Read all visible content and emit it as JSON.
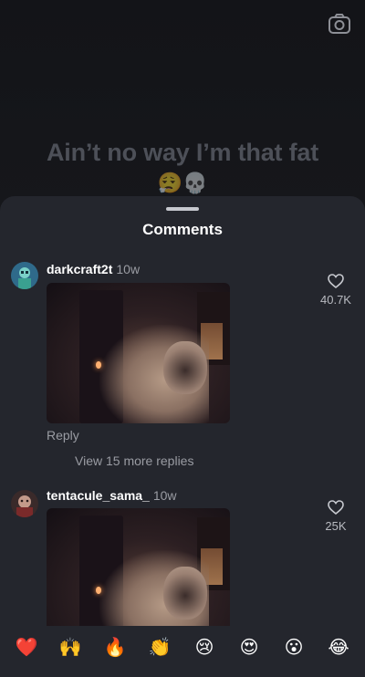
{
  "video": {
    "caption": "Ain’t no way I’m that fat",
    "caption_emojis": "😮‍💨💀"
  },
  "comments_sheet": {
    "title": "Comments",
    "comments": [
      {
        "username": "darkcraft2t",
        "time": "10w",
        "likes": "40.7K",
        "reply_label": "Reply",
        "more_replies": "View 15 more replies"
      },
      {
        "username": "tentacule_sama_",
        "time": "10w",
        "likes": "25K"
      }
    ]
  },
  "emoji_bar": [
    "❤️",
    "🙌",
    "🔥",
    "👏",
    "😢",
    "😍",
    "😮",
    "😂"
  ],
  "colors": {
    "sheet_background": "#24262d",
    "secondary_text": "#9a9ca3"
  }
}
